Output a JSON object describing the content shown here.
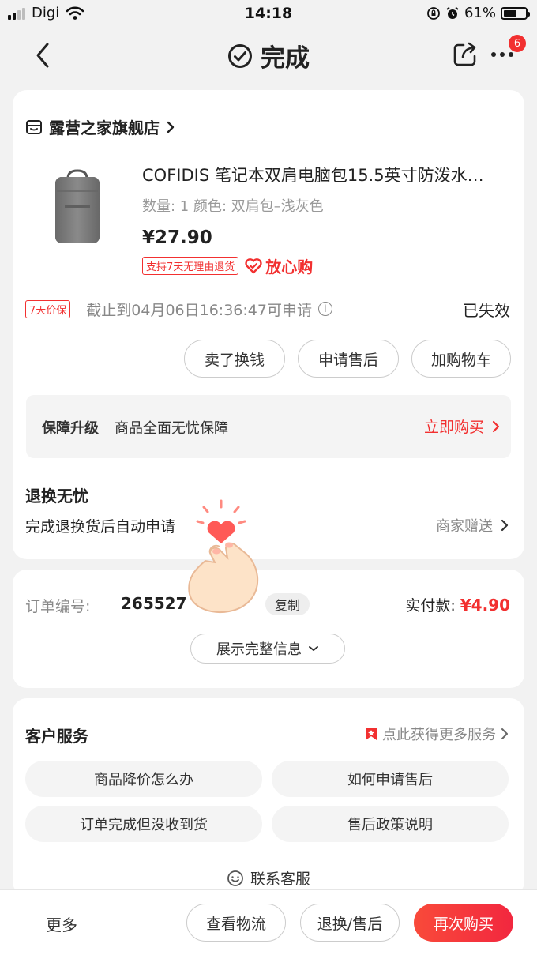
{
  "status_bar": {
    "carrier": "Digi",
    "time": "14:18",
    "battery": "61%",
    "battery_level": 0.61
  },
  "header": {
    "title": "完成",
    "notification_count": "6"
  },
  "store": {
    "name": "露营之家旗舰店"
  },
  "product": {
    "title": "COFIDIS 笔记本双肩电脑包15.5英寸防泼水…",
    "spec": "数量: 1  颜色: 双肩包–浅灰色",
    "price": "¥27.90",
    "return_tag": "支持7天无理由退货",
    "assurance": "放心购"
  },
  "price_protect": {
    "tag": "7天价保",
    "text": "截止到04月06日16:36:47可申请",
    "status": "已失效"
  },
  "actions": {
    "sell": "卖了换钱",
    "after_sale": "申请售后",
    "add_cart": "加购物车"
  },
  "upgrade": {
    "label": "保障升级",
    "desc": "商品全面无忧保障",
    "buy": "立即购买"
  },
  "worry_free": {
    "title": "退换无忧",
    "desc": "完成退换货后自动申请",
    "gift": "商家赠送"
  },
  "order": {
    "label": "订单编号:",
    "number": "265527",
    "copy": "复制",
    "paid_label": "实付款:",
    "paid_amount": "¥4.90",
    "expand": "展示完整信息"
  },
  "customer_service": {
    "title": "客户服务",
    "more": "点此获得更多服务",
    "items": [
      {
        "label": "商品降价怎么办"
      },
      {
        "label": "如何申请售后"
      },
      {
        "label": "订单完成但没收到货"
      },
      {
        "label": "售后政策说明"
      }
    ],
    "contact": "联系客服"
  },
  "bottom_bar": {
    "more": "更多",
    "logistics": "查看物流",
    "returns": "退换/售后",
    "rebuy": "再次购买"
  },
  "colors": {
    "accent": "#f23030",
    "primary_gradient_start": "#f94a3a",
    "primary_gradient_end": "#f2273f"
  }
}
